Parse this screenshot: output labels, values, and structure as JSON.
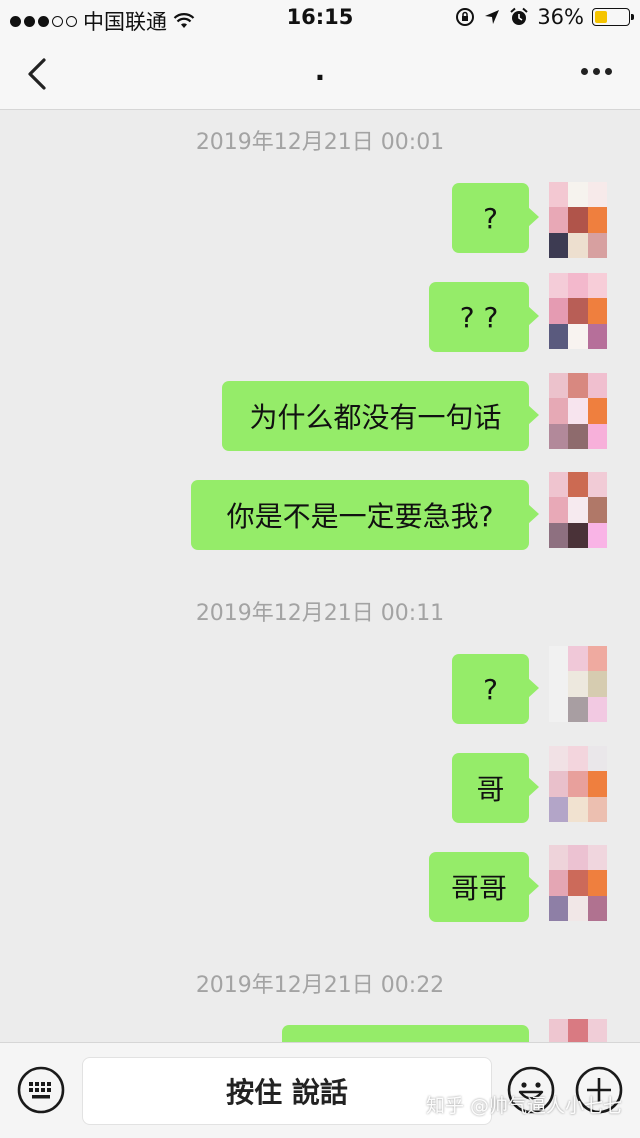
{
  "status_bar": {
    "carrier": "中国联通",
    "time": "16:15",
    "battery": "36%",
    "battery_level": 0.36,
    "signal_bars_filled": 3,
    "signal_bars_total": 5
  },
  "nav": {
    "title": "."
  },
  "timestamps": [
    "2019年12月21日 00:01",
    "2019年12月21日 00:11",
    "2019年12月21日 00:22"
  ],
  "messages": [
    {
      "text": "?"
    },
    {
      "text": "? ?"
    },
    {
      "text": "为什么都没有一句话"
    },
    {
      "text": "你是不是一定要急我?"
    },
    {
      "text": "?"
    },
    {
      "text": "哥"
    },
    {
      "text": "哥哥"
    },
    {
      "text": ""
    }
  ],
  "input_bar": {
    "voice_label": "按住 說話"
  },
  "watermark": "知乎 @帅气逼人小七七",
  "colors": {
    "bubble": "#95ec69",
    "background": "#ececec",
    "timestamp": "#a3a3a3"
  },
  "icons": [
    "signal-dots",
    "wifi-icon",
    "lock-rotation-icon",
    "location-arrow-icon",
    "alarm-icon",
    "battery-icon",
    "back-chevron-icon",
    "more-dots-icon",
    "keyboard-icon",
    "emoji-icon",
    "plus-icon"
  ]
}
